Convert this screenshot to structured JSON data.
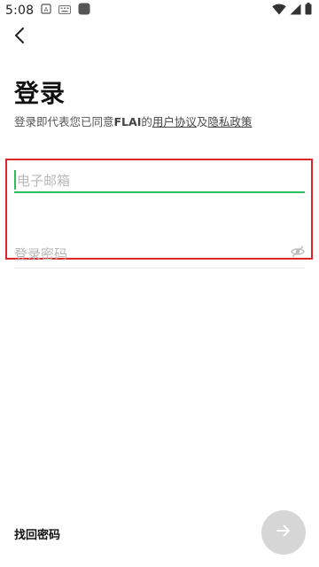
{
  "status_bar": {
    "time": "5:08",
    "icons_left": [
      "shield-a-icon",
      "keyboard-icon",
      "app-square-icon"
    ],
    "icons_right": [
      "wifi-icon",
      "cellular-icon",
      "battery-icon"
    ]
  },
  "header": {
    "back_icon": "chevron-left-icon",
    "title": "登录"
  },
  "agreement": {
    "prefix": "登录即代表您已同意",
    "brand": "FLAI",
    "of": "的",
    "user_agreement": "用户协议",
    "and": "及",
    "privacy_policy": "隐私政策"
  },
  "form": {
    "email_placeholder": "电子邮箱",
    "password_placeholder": "登录密码",
    "password_toggle_icon": "eye-slash-icon"
  },
  "footer": {
    "forgot_password": "找回密码",
    "next_icon": "arrow-right-icon"
  },
  "colors": {
    "accent": "#2bbf5d",
    "highlight": "#e0262b",
    "next_button_disabled": "#d6d6d6"
  }
}
